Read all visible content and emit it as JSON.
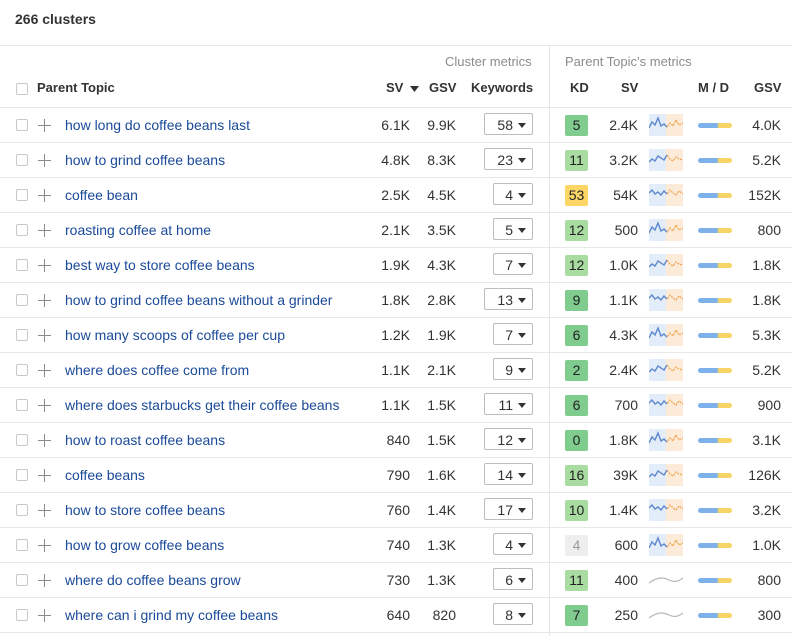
{
  "header": {
    "title": "266 clusters"
  },
  "columns": {
    "group_cluster": "Cluster metrics",
    "group_parent": "Parent Topic’s metrics",
    "parent_topic": "Parent Topic",
    "sv": "SV",
    "sort_icon": "caret-down-icon",
    "gsv": "GSV",
    "keywords": "Keywords",
    "kd": "KD",
    "psv": "SV",
    "md": "M / D",
    "pgsv": "GSV"
  },
  "colors": {
    "link": "#1a4a99",
    "kd_green": "#7fcc8e",
    "kd_light_green": "#a9dca0",
    "kd_yellow": "#fdd666",
    "kd_gray": "#eeeeee",
    "spark_blue": "#5b8ad6",
    "spark_orange": "#f0a24a",
    "spark_gray": "#b8b8b8",
    "md_blue": "#6fa8e8",
    "md_yellow": "#f5d055"
  },
  "rows": [
    {
      "keyword": "how long do coffee beans last",
      "sv": "6.1K",
      "gsv": "9.9K",
      "keywords": "58",
      "kd": "5",
      "kd_color": "#7fcc8e",
      "psv": "2.4K",
      "trend": "color",
      "pgsv": "4.0K"
    },
    {
      "keyword": "how to grind coffee beans",
      "sv": "4.8K",
      "gsv": "8.3K",
      "keywords": "23",
      "kd": "11",
      "kd_color": "#a9dca0",
      "psv": "3.2K",
      "trend": "color",
      "pgsv": "5.2K"
    },
    {
      "keyword": "coffee bean",
      "sv": "2.5K",
      "gsv": "4.5K",
      "keywords": "4",
      "kd": "53",
      "kd_color": "#fdd666",
      "psv": "54K",
      "trend": "color",
      "pgsv": "152K"
    },
    {
      "keyword": "roasting coffee at home",
      "sv": "2.1K",
      "gsv": "3.5K",
      "keywords": "5",
      "kd": "12",
      "kd_color": "#a9dca0",
      "psv": "500",
      "trend": "color",
      "pgsv": "800"
    },
    {
      "keyword": "best way to store coffee beans",
      "sv": "1.9K",
      "gsv": "4.3K",
      "keywords": "7",
      "kd": "12",
      "kd_color": "#a9dca0",
      "psv": "1.0K",
      "trend": "color",
      "pgsv": "1.8K"
    },
    {
      "keyword": "how to grind coffee beans without a grinder",
      "sv": "1.8K",
      "gsv": "2.8K",
      "keywords": "13",
      "kd": "9",
      "kd_color": "#7fcc8e",
      "psv": "1.1K",
      "trend": "color",
      "pgsv": "1.8K"
    },
    {
      "keyword": "how many scoops of coffee per cup",
      "sv": "1.2K",
      "gsv": "1.9K",
      "keywords": "7",
      "kd": "6",
      "kd_color": "#7fcc8e",
      "psv": "4.3K",
      "trend": "color",
      "pgsv": "5.3K"
    },
    {
      "keyword": "where does coffee come from",
      "sv": "1.1K",
      "gsv": "2.1K",
      "keywords": "9",
      "kd": "2",
      "kd_color": "#7fcc8e",
      "psv": "2.4K",
      "trend": "color",
      "pgsv": "5.2K"
    },
    {
      "keyword": "where does starbucks get their coffee beans",
      "sv": "1.1K",
      "gsv": "1.5K",
      "keywords": "11",
      "kd": "6",
      "kd_color": "#7fcc8e",
      "psv": "700",
      "trend": "color",
      "pgsv": "900"
    },
    {
      "keyword": "how to roast coffee beans",
      "sv": "840",
      "gsv": "1.5K",
      "keywords": "12",
      "kd": "0",
      "kd_color": "#7fcc8e",
      "psv": "1.8K",
      "trend": "color",
      "pgsv": "3.1K"
    },
    {
      "keyword": "coffee beans",
      "sv": "790",
      "gsv": "1.6K",
      "keywords": "14",
      "kd": "16",
      "kd_color": "#a9dca0",
      "psv": "39K",
      "trend": "color",
      "pgsv": "126K"
    },
    {
      "keyword": "how to store coffee beans",
      "sv": "760",
      "gsv": "1.4K",
      "keywords": "17",
      "kd": "10",
      "kd_color": "#a9dca0",
      "psv": "1.4K",
      "trend": "color",
      "pgsv": "3.2K"
    },
    {
      "keyword": "how to grow coffee beans",
      "sv": "740",
      "gsv": "1.3K",
      "keywords": "4",
      "kd": "4",
      "kd_color": "#eeeeee",
      "psv": "600",
      "trend": "color",
      "pgsv": "1.0K"
    },
    {
      "keyword": "where do coffee beans grow",
      "sv": "730",
      "gsv": "1.3K",
      "keywords": "6",
      "kd": "11",
      "kd_color": "#a9dca0",
      "psv": "400",
      "trend": "gray",
      "pgsv": "800"
    },
    {
      "keyword": "where can i grind my coffee beans",
      "sv": "640",
      "gsv": "820",
      "keywords": "8",
      "kd": "7",
      "kd_color": "#7fcc8e",
      "psv": "250",
      "trend": "gray",
      "pgsv": "300"
    }
  ]
}
